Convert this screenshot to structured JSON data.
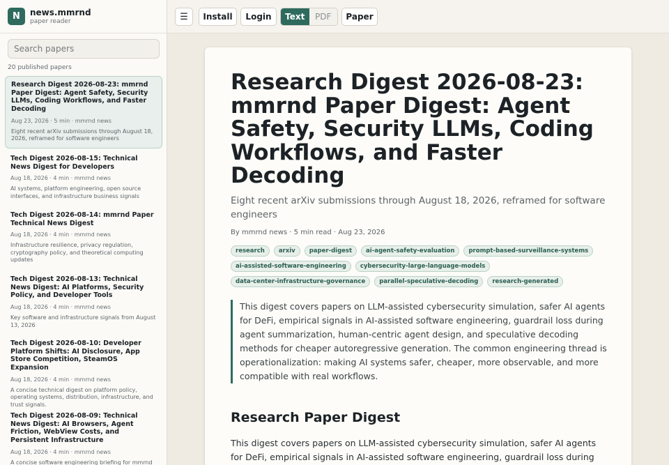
{
  "brand": {
    "logo_letter": "N",
    "name": "news.mmrnd",
    "subtitle": "paper reader"
  },
  "search": {
    "placeholder": "Search papers",
    "value": ""
  },
  "sidebar": {
    "count_label": "20 published papers",
    "posts": [
      {
        "title": "Research Digest 2026-08-23: mmrnd Paper Digest: Agent Safety, Security LLMs, Coding Workflows, and Faster Decoding",
        "meta": "Aug 23, 2026 · 5 min · mmrnd news",
        "desc": "Eight recent arXiv submissions through August 18, 2026, reframed for software engineers",
        "active": true
      },
      {
        "title": "Tech Digest 2026-08-15: Technical News Digest for Developers",
        "meta": "Aug 18, 2026 · 4 min · mmrnd news",
        "desc": "AI systems, platform engineering, open source interfaces, and infrastructure business signals"
      },
      {
        "title": "Tech Digest 2026-08-14: mmrnd Paper Technical News Digest",
        "meta": "Aug 18, 2026 · 4 min · mmrnd news",
        "desc": "Infrastructure resilience, privacy regulation, cryptography policy, and theoretical computing updates"
      },
      {
        "title": "Tech Digest 2026-08-13: Technical News Digest: AI Platforms, Security Policy, and Developer Tools",
        "meta": "Aug 18, 2026 · 4 min · mmrnd news",
        "desc": "Key software and infrastructure signals from August 13, 2026"
      },
      {
        "title": "Tech Digest 2026-08-10: Developer Platform Shifts: AI Disclosure, App Store Competition, SteamOS Expansion",
        "meta": "Aug 18, 2026 · 4 min · mmrnd news",
        "desc": "A concise technical digest on platform policy, operating systems, distribution, infrastructure, and trust signals."
      },
      {
        "title": "Tech Digest 2026-08-09: Technical News Digest: AI Browsers, Agent Friction, WebView Costs, and Persistent Infrastructure",
        "meta": "Aug 18, 2026 · 4 min · mmrnd news",
        "desc": "A concise software engineering briefing for mmrnd"
      }
    ]
  },
  "toolbar": {
    "menu_icon": "☰",
    "install_label": "Install",
    "login_label": "Login",
    "view_text_label": "Text",
    "view_pdf_label": "PDF",
    "paper_label": "Paper",
    "active_view": "Text"
  },
  "article": {
    "title": "Research Digest 2026-08-23: mmrnd Paper Digest: Agent Safety, Security LLMs, Coding Workflows, and Faster Decoding",
    "subtitle": "Eight recent arXiv submissions through August 18, 2026, reframed for software engineers",
    "byline": "By mmrnd news · 5 min read · Aug 23, 2026",
    "tags": [
      "research",
      "arxiv",
      "paper-digest",
      "ai-agent-safety-evaluation",
      "prompt-based-surveillance-systems",
      "ai-assisted-software-engineering",
      "cybersecurity-large-language-models",
      "data-center-infrastructure-governance",
      "parallel-speculative-decoding",
      "research-generated"
    ],
    "summary": "This digest covers papers on LLM-assisted cybersecurity simulation, safer AI agents for DeFi, empirical signals in AI-assisted software engineering, guardrail loss during agent summarization, human-centric agent design, and speculative decoding methods for cheaper autoregressive generation. The common engineering thread is operationalization: making AI systems safer, cheaper, more observable, and more compatible with real workflows.",
    "section_heading": "Research Paper Digest",
    "section_body": "This digest covers papers on LLM-assisted cybersecurity simulation, safer AI agents for DeFi, empirical signals in AI-assisted software engineering, guardrail loss during agent"
  },
  "colors": {
    "accent": "#2e6b5e",
    "background": "#efebe2",
    "card": "#fdfcf8",
    "tag_bg": "#e8efe9"
  }
}
